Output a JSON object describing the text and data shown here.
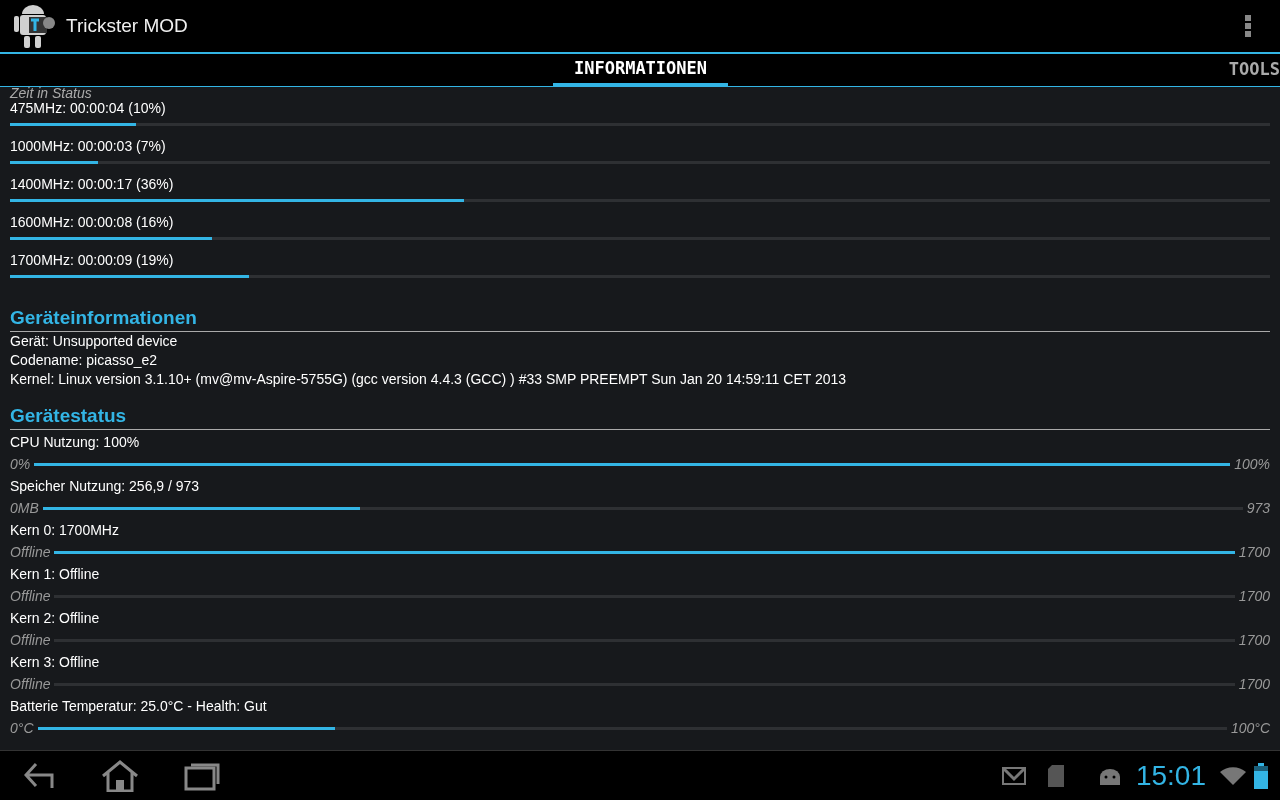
{
  "app_bar": {
    "title": "Trickster MOD"
  },
  "tabs": [
    {
      "label": "INFORMATIONEN",
      "selected": true
    },
    {
      "label": "TOOLS",
      "selected": false
    }
  ],
  "time_in_state": {
    "heading": "Zeit in Status",
    "rows": [
      {
        "label": "475MHz: 00:00:04 (10%)",
        "level": 0.1
      },
      {
        "label": "1000MHz: 00:00:03 (7%)",
        "level": 0.07
      },
      {
        "label": "1400MHz: 00:00:17 (36%)",
        "level": 0.36
      },
      {
        "label": "1600MHz: 00:00:08 (16%)",
        "level": 0.16
      },
      {
        "label": "1700MHz: 00:00:09 (19%)",
        "level": 0.19
      }
    ]
  },
  "device_info": {
    "heading": "Geräteinformationen",
    "lines": [
      "Gerät: Unsupported device",
      "Codename: picasso_e2",
      "Kernel: Linux version 3.1.10+ (mv@mv-Aspire-5755G) (gcc version 4.4.3 (GCC) ) #33 SMP PREEMPT Sun Jan 20 14:59:11 CET 2013"
    ]
  },
  "device_status": {
    "heading": "Gerätestatus",
    "rows": [
      {
        "label": "CPU Nutzung: 100%",
        "min": "0%",
        "max": "100%",
        "level": 1.0
      },
      {
        "label": "Speicher Nutzung: 256,9 / 973",
        "min": "0MB",
        "max": "973",
        "level": 0.264
      },
      {
        "label": "Kern 0: 1700MHz",
        "min": "Offline",
        "max": "1700",
        "level": 1.0
      },
      {
        "label": "Kern 1: Offline",
        "min": "Offline",
        "max": "1700",
        "level": 0
      },
      {
        "label": "Kern 2: Offline",
        "min": "Offline",
        "max": "1700",
        "level": 0
      },
      {
        "label": "Kern 3: Offline",
        "min": "Offline",
        "max": "1700",
        "level": 0
      },
      {
        "label": "Batterie Temperatur: 25.0°C - Health: Gut",
        "min": "0°C",
        "max": "100°C",
        "level": 0.25
      }
    ]
  },
  "status_bar": {
    "clock": "15:01"
  }
}
